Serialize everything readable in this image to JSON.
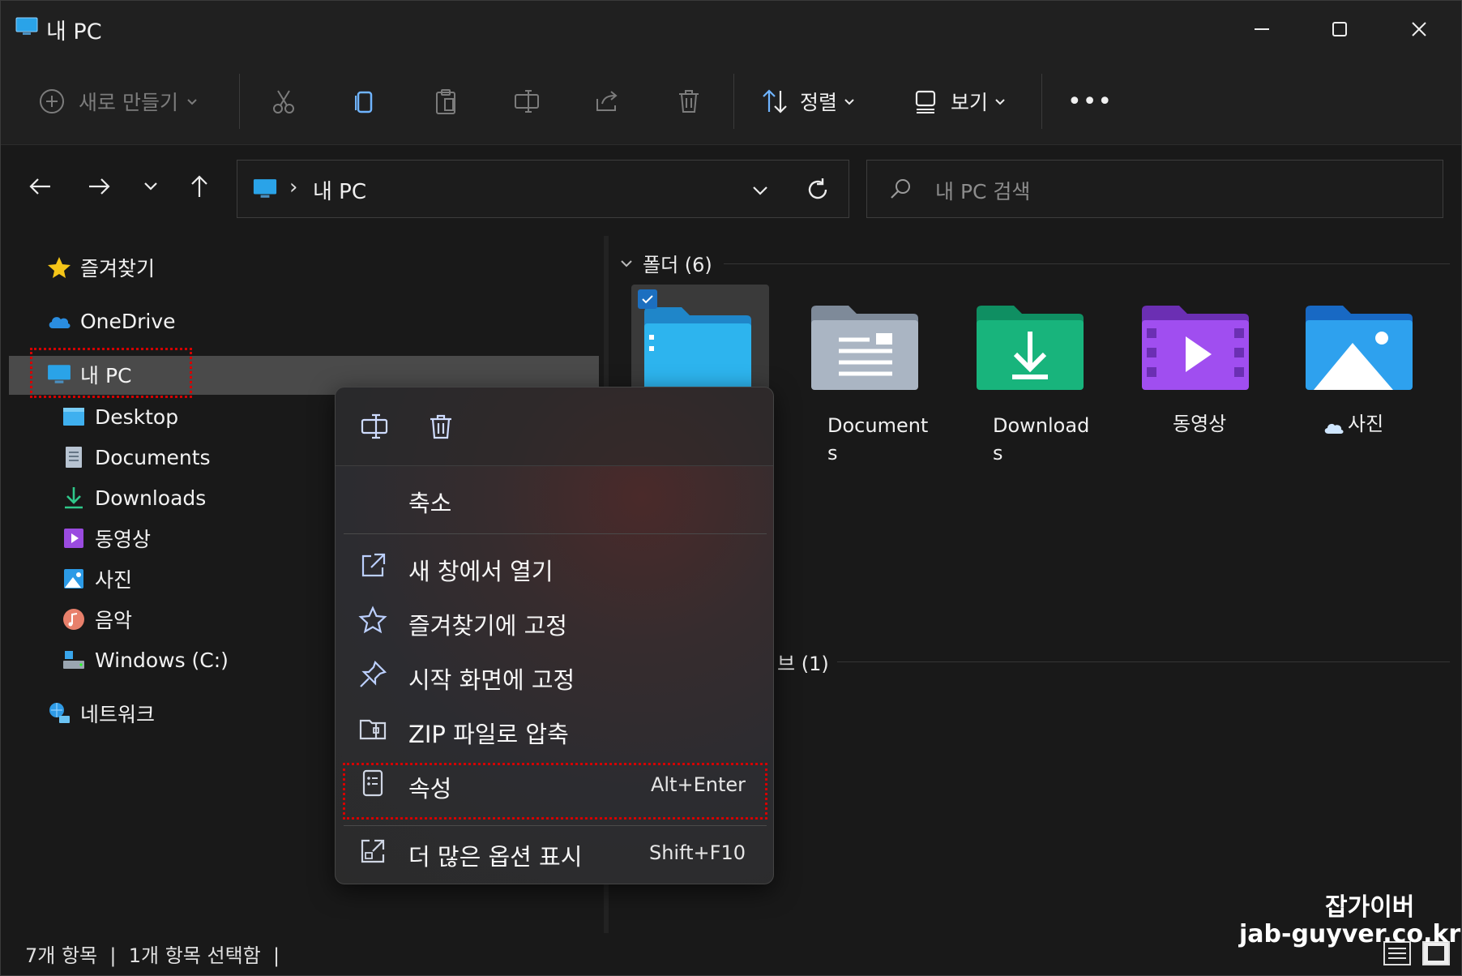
{
  "window": {
    "title": "내 PC"
  },
  "toolbar": {
    "new_label": "새로 만들기",
    "sort_label": "정렬",
    "view_label": "보기",
    "more_label": "•••"
  },
  "address": {
    "path": "내 PC",
    "separator": "›"
  },
  "search": {
    "placeholder": "내 PC 검색"
  },
  "nav": {
    "favorites": "즐겨찾기",
    "onedrive": "OneDrive",
    "thispc": "내 PC",
    "desktop": "Desktop",
    "documents": "Documents",
    "downloads": "Downloads",
    "videos": "동영상",
    "pictures": "사진",
    "music": "음악",
    "windows": "Windows (C:)",
    "network": "네트워크"
  },
  "content": {
    "folders_header": "폴더 (6)",
    "drives_header_partial": "브 (1)",
    "folders": [
      {
        "line1": "Document",
        "line2": "s"
      },
      {
        "line1": "Download",
        "line2": "s"
      },
      {
        "line1": "동영상",
        "line2": ""
      },
      {
        "line1": "사진",
        "line2": ""
      }
    ]
  },
  "context_menu": {
    "collapse": "축소",
    "open_new_window": "새 창에서 열기",
    "pin_favorites": "즐겨찾기에 고정",
    "pin_start": "시작 화면에 고정",
    "zip": "ZIP 파일로 압축",
    "properties": "속성",
    "properties_shortcut": "Alt+Enter",
    "more_options": "더 많은 옵션 표시",
    "more_options_shortcut": "Shift+F10"
  },
  "status": {
    "text": "7개 항목  |  1개 항목 선택함  |"
  },
  "watermark": {
    "line1": "잡가이버",
    "line2": "jab-guyver.co.kr"
  },
  "colors": {
    "accent": "#0078d4",
    "highlight_box": "#d40000",
    "selection": "#4a4a4a"
  }
}
